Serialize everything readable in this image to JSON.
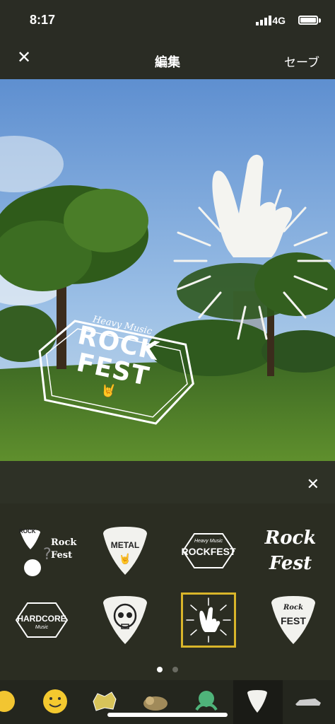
{
  "status": {
    "time": "8:17",
    "network": "4G"
  },
  "nav": {
    "close_glyph": "✕",
    "title": "編集",
    "save": "セーブ"
  },
  "photo": {
    "sticker_rockfest": {
      "top": "Heavy Music",
      "main1": "ROCK",
      "main2": "FEST"
    }
  },
  "panel": {
    "close_glyph": "✕"
  },
  "stickers": [
    {
      "name": "mixed-mini-pack",
      "label1": "ROCK",
      "label2": "Rock",
      "label3": "Fest"
    },
    {
      "name": "metal-pick",
      "label": "METAL"
    },
    {
      "name": "rockfest-badge",
      "label1": "Heavy Music",
      "label2": "ROCKFEST"
    },
    {
      "name": "rock-fest-script",
      "label1": "Rock",
      "label2": "Fest"
    },
    {
      "name": "hardcore-badge",
      "label1": "HARDCORE",
      "label2": "Music"
    },
    {
      "name": "skull-pick"
    },
    {
      "name": "rock-hand-burst",
      "selected": true
    },
    {
      "name": "rock-fest-pick",
      "label1": "Rock",
      "label2": "FEST"
    }
  ],
  "pager": {
    "pages": 2,
    "current": 1
  },
  "tray": [
    "sticker-category-emoji-partial",
    "sticker-category-smiley",
    "sticker-category-comic",
    "sticker-category-animal",
    "sticker-category-character",
    "sticker-category-rock",
    "sticker-category-car"
  ]
}
